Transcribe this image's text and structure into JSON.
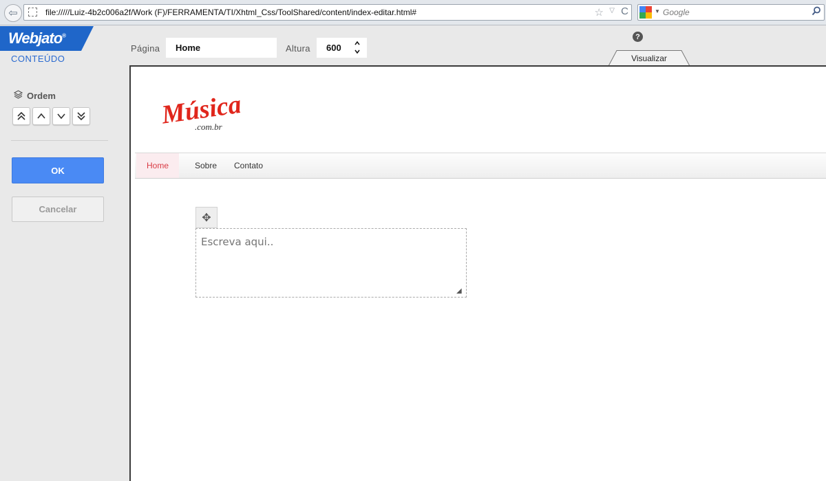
{
  "browser": {
    "url": "file://///Luiz-4b2c006a2f/Work  (F)/FERRAMENTA/TI/Xhtml_Css/ToolShared/content/index-editar.html#",
    "search_placeholder": "Google",
    "back_glyph": "⇦",
    "star_glyph": "☆",
    "drop_glyph": "▽",
    "reload_glyph": "C",
    "search_glyph": "⚲"
  },
  "app": {
    "brand": "Webjato",
    "brand_mark": "®",
    "section": "CONTEÚDO",
    "brand_color": "#1f66c9"
  },
  "ordem": {
    "label": "Ordem",
    "icon_glyph": "≋",
    "buttons": [
      "⩓",
      "∧",
      "∨",
      "⩔"
    ]
  },
  "actions": {
    "ok": "OK",
    "cancel": "Cancelar",
    "ok_color": "#4a8af4"
  },
  "controls": {
    "pagina_label": "Página",
    "pagina_value": "Home",
    "altura_label": "Altura",
    "altura_value": "600",
    "help_glyph": "?",
    "preview_tab": "Visualizar"
  },
  "site": {
    "logo_text": "Música",
    "logo_sub": ".com.br",
    "nav": [
      "Home",
      "Sobre",
      "Contato"
    ],
    "nav_active_color": "#d93a44",
    "move_glyph": "✥",
    "editor_placeholder": "Escreva aqui.."
  }
}
